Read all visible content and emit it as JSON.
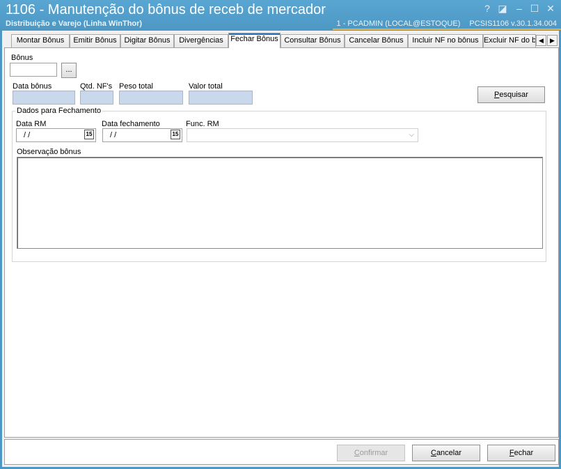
{
  "window": {
    "title": "1106 - Manutenção do bônus de receb de mercador",
    "subtitle": "Distribuição e Varejo (Linha WinThor)",
    "user_info": "1 - PCADMIN (LOCAL@ESTOQUE)",
    "version_info": "PCSIS1106  v.30.1.34.004",
    "controls": {
      "help": "?",
      "restore": "◪",
      "minimize": "‒",
      "maximize": "☐",
      "close": "✕"
    }
  },
  "tabs": [
    "Montar Bônus",
    "Emitir Bônus",
    "Digitar Bônus",
    "Divergências",
    "Fechar Bônus",
    "Consultar Bônus",
    "Cancelar Bônus",
    "Incluir NF no bônus",
    "Excluir NF do b"
  ],
  "active_tab": "Fechar Bônus",
  "tab_scroll": {
    "left": "◀",
    "right": "▶"
  },
  "form": {
    "bonus_label": "Bônus",
    "bonus_value": "",
    "lookup_button": "...",
    "data_bonus_label": "Data bônus",
    "qtd_nfs_label": "Qtd. NF's",
    "peso_total_label": "Peso total",
    "valor_total_label": "Valor total",
    "search_button_first": "P",
    "search_button_rest": "esquisar",
    "group_title": "Dados para Fechamento",
    "data_rm_label": "Data RM",
    "data_rm_value": "/ /",
    "data_fechamento_label": "Data fechamento",
    "data_fechamento_value": "/ /",
    "calendar_glyph": "15",
    "func_rm_label": "Func. RM",
    "func_rm_value": "",
    "observacao_label": "Observação bônus",
    "observacao_value": ""
  },
  "footer": {
    "confirm_first": "C",
    "confirm_rest": "onfirmar",
    "cancel_first": "C",
    "cancel_rest": "ancelar",
    "close_first": "F",
    "close_rest": "echar"
  },
  "colors": {
    "titlebar": "#4c97c4",
    "accent": "#e1b54a",
    "readonly_field": "#c9d8ea",
    "active_tab_marker": "#2a6fb5"
  }
}
